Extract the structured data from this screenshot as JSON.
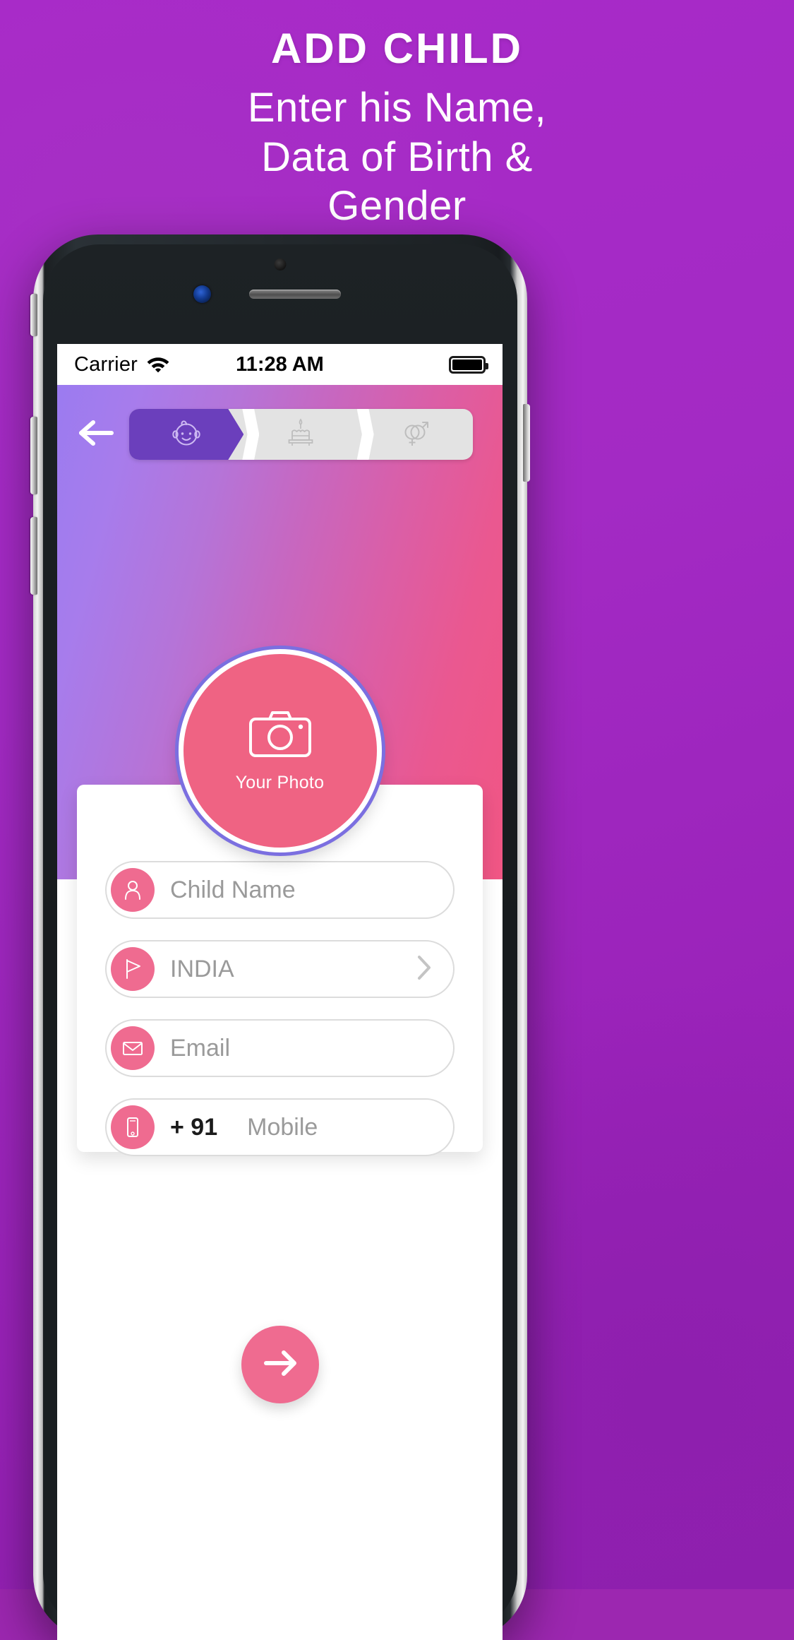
{
  "promo": {
    "title": "ADD CHILD",
    "subtitle_lines": [
      "Enter his Name,",
      "Data of Birth &",
      "Gender"
    ]
  },
  "status_bar": {
    "carrier": "Carrier",
    "wifi_icon": "wifi-icon",
    "time": "11:28 AM",
    "battery_icon": "battery-full-icon"
  },
  "app": {
    "back_icon": "arrow-left-icon",
    "stepper": {
      "steps": [
        {
          "icon": "baby-face-icon",
          "state": "active"
        },
        {
          "icon": "birthday-cake-icon",
          "state": "inactive"
        },
        {
          "icon": "gender-symbols-icon",
          "state": "inactive"
        }
      ]
    },
    "photo": {
      "icon": "camera-icon",
      "label": "Your Photo"
    },
    "form": {
      "fields": [
        {
          "name": "child-name",
          "icon": "person-icon",
          "placeholder": "Child Name",
          "value": ""
        },
        {
          "name": "country",
          "icon": "flag-icon",
          "placeholder": "INDIA",
          "value": "",
          "accessory_icon": "chevron-right-icon"
        },
        {
          "name": "email",
          "icon": "envelope-icon",
          "placeholder": "Email",
          "value": ""
        },
        {
          "name": "mobile",
          "icon": "smartphone-icon",
          "prefix": "+ 91",
          "placeholder": "Mobile",
          "value": ""
        }
      ]
    },
    "next_button": {
      "icon": "arrow-right-icon"
    }
  },
  "colors": {
    "promo_bg": "#a32ac4",
    "hero_gradient_start": "#9b7bf0",
    "hero_gradient_end": "#f15684",
    "accent_pink": "#ef6b90",
    "step_active_purple": "#6b3fbc",
    "step_inactive_gray": "#e3e3e3"
  }
}
